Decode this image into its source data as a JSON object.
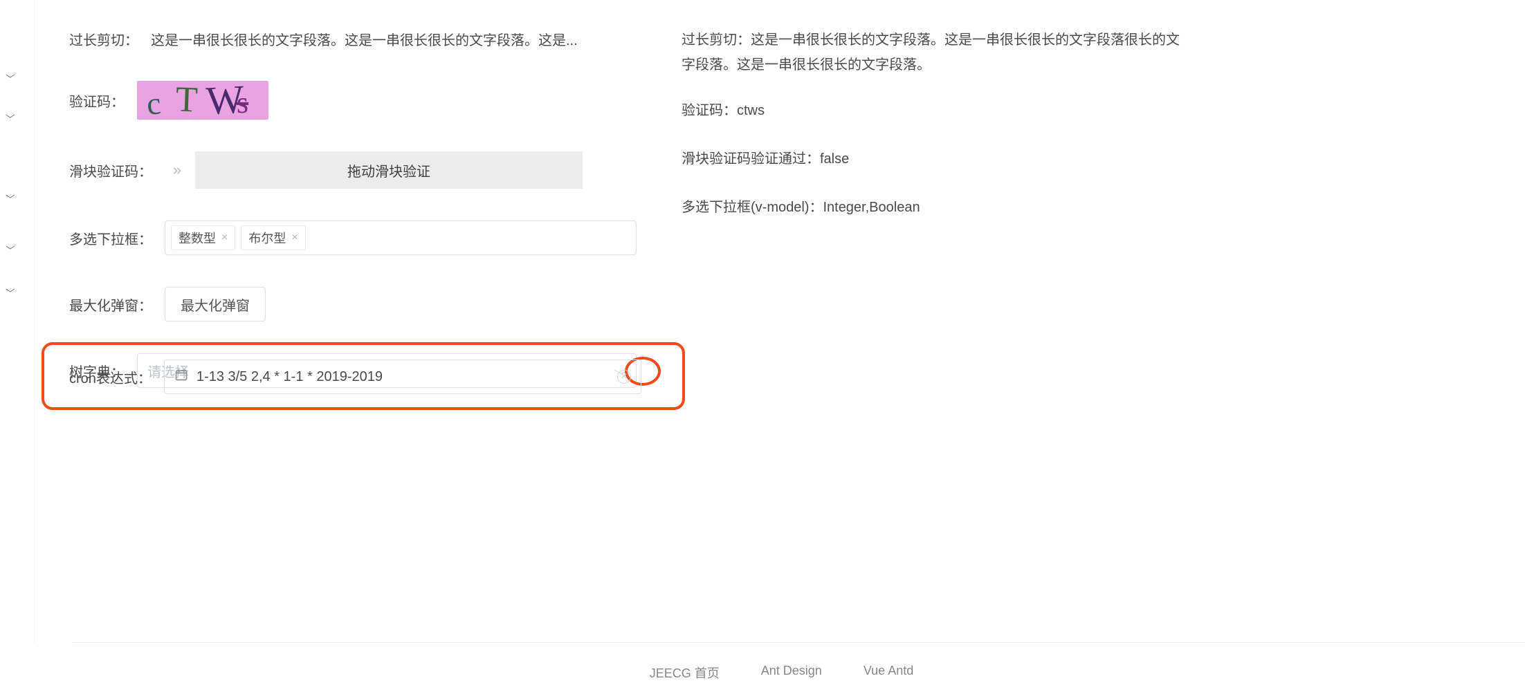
{
  "sidebar": {
    "chevron_glyph": "⌵"
  },
  "form": {
    "truncate": {
      "label": "过长剪切：",
      "value": "这是一串很长很长的文字段落。这是一串很长很长的文字段落。这是..."
    },
    "captcha": {
      "label": "验证码：",
      "chars": [
        "c",
        "T",
        "W",
        "s"
      ]
    },
    "slider": {
      "label": "滑块验证码：",
      "handle_glyph": "»",
      "track_text": "拖动滑块验证"
    },
    "multi": {
      "label": "多选下拉框：",
      "tags": [
        "整数型",
        "布尔型"
      ]
    },
    "max_dialog": {
      "label": "最大化弹窗：",
      "button": "最大化弹窗"
    },
    "tree_dict": {
      "label": "树字典：",
      "placeholder": "请选择"
    },
    "cron": {
      "label": "cron表达式：",
      "value": "1-13 3/5 2,4 * 1-1 * 2019-2019"
    }
  },
  "info": {
    "truncate_full": "过长剪切：这是一串很长很长的文字段落。这是一串很长很长的文字段落很长的文字段落。这是一串很长很长的文字段落。",
    "captcha": "验证码：ctws",
    "slider_pass": "滑块验证码验证通过：false",
    "multi_model": "多选下拉框(v-model)：Integer,Boolean"
  },
  "footer": {
    "left": "JEECG 首页",
    "mid": "Ant Design",
    "right": "Vue Antd"
  }
}
